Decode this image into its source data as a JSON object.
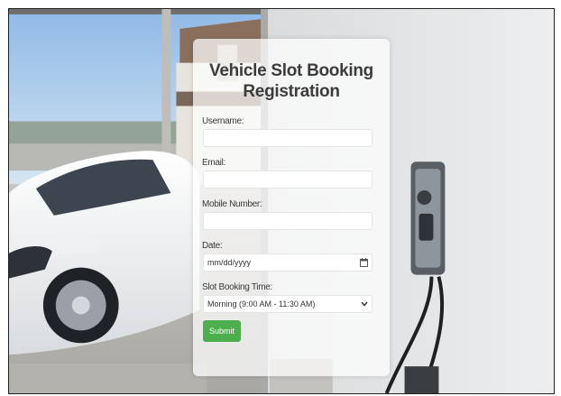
{
  "form": {
    "title": "Vehicle Slot Booking Registration",
    "username_label": "Username:",
    "username_value": "",
    "email_label": "Email:",
    "email_value": "",
    "mobile_label": "Mobile Number:",
    "mobile_value": "",
    "date_label": "Date:",
    "date_placeholder": "mm/dd/yyyy",
    "time_label": "Slot Booking Time:",
    "time_selected": "Morning (9:00 AM - 11:30 AM)",
    "submit_label": "Submit"
  },
  "colors": {
    "submit_button": "#4cae4c",
    "card_background": "rgba(255,255,255,0.72)",
    "title_text": "#3c3c3c"
  },
  "icons": {
    "date": "calendar-icon",
    "select": "chevron-down-icon"
  }
}
